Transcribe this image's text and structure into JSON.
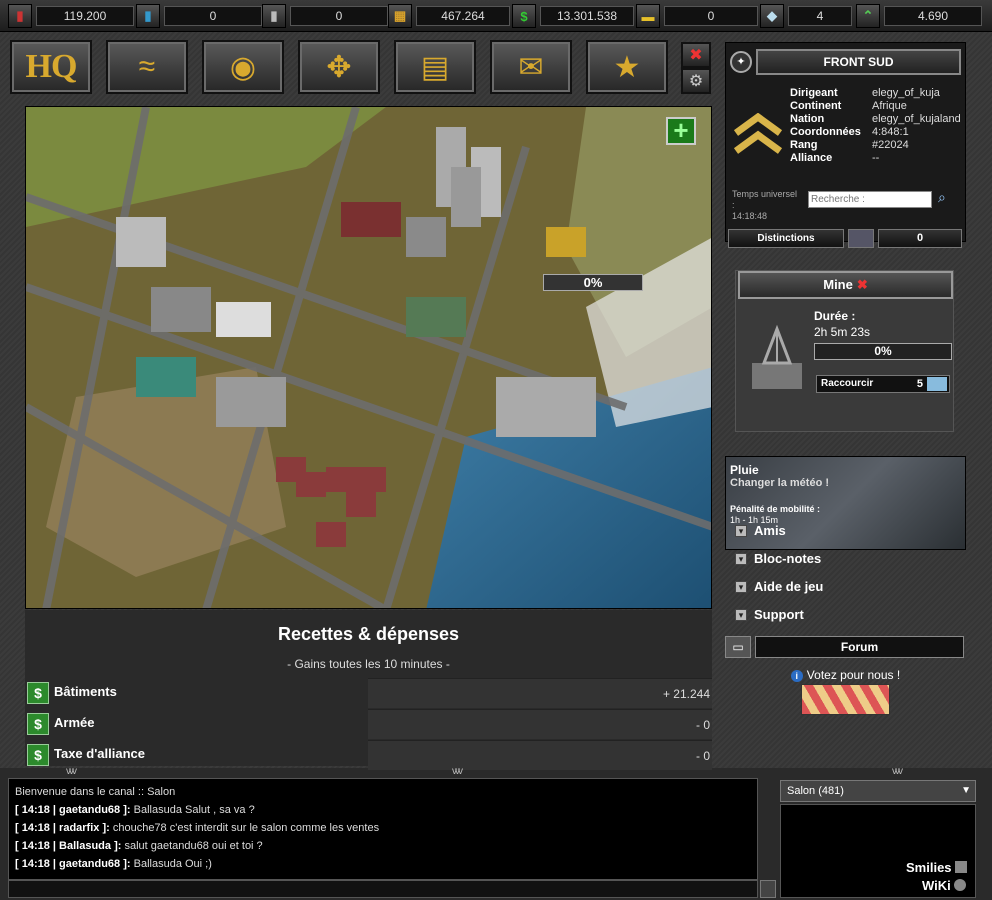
{
  "resources": [
    {
      "icon": "oil-barrel-icon",
      "glyph": "▮",
      "color": "#c33",
      "value": "119.200"
    },
    {
      "icon": "fuel-barrel-icon",
      "glyph": "▮",
      "color": "#39c",
      "value": "0"
    },
    {
      "icon": "steel-barrel-icon",
      "glyph": "▮",
      "color": "#bbb",
      "value": "0"
    },
    {
      "icon": "supply-crates-icon",
      "glyph": "▦",
      "color": "#d9a22a",
      "value": "467.264"
    },
    {
      "icon": "dollar-icon",
      "glyph": "$",
      "color": "#3c3",
      "value": "13.301.538"
    },
    {
      "icon": "gold-bar-icon",
      "glyph": "▬",
      "color": "#e6c02a",
      "value": "0"
    },
    {
      "icon": "diamond-icon",
      "glyph": "◆",
      "color": "#bde",
      "value": "4"
    },
    {
      "icon": "rank-up-icon",
      "glyph": "⌃",
      "color": "#5c5",
      "value": "4.690"
    }
  ],
  "nav": {
    "hq": "HQ",
    "items": [
      "map-icon",
      "globe-icon",
      "alliance-icon",
      "reports-icon",
      "mail-icon",
      "star-icon"
    ]
  },
  "map": {
    "progress": "0%"
  },
  "income": {
    "title": "Recettes & dépenses",
    "subtitle": "- Gains toutes les 10 minutes -",
    "rows": [
      {
        "label": "Bâtiments",
        "value": "+ 21.244"
      },
      {
        "label": "Armée",
        "value": "- 0"
      },
      {
        "label": "Taxe d'alliance",
        "value": "- 0"
      }
    ]
  },
  "front": {
    "title": "FRONT SUD",
    "info": [
      {
        "k": "Dirigeant",
        "v": "elegy_of_kuja"
      },
      {
        "k": "Continent",
        "v": "Afrique"
      },
      {
        "k": "Nation",
        "v": "elegy_of_kujaland"
      },
      {
        "k": "Coordonnées",
        "v": "4:848:1"
      },
      {
        "k": "Rang",
        "v": "#22024"
      },
      {
        "k": "Alliance",
        "v": "--"
      }
    ],
    "temps_label": "Temps universel :",
    "temps_value": "14:18:48",
    "search_placeholder": "Recherche :",
    "distinctions_label": "Distinctions",
    "distinctions_value": "0"
  },
  "mine": {
    "title": "Mine",
    "close": "✖",
    "duree_label": "Durée :",
    "duree_value": "2h 5m 23s",
    "progress": "0%",
    "raccourcir_label": "Raccourcir",
    "raccourcir_value": "5"
  },
  "weather": {
    "name": "Pluie",
    "action": "Changer la météo !",
    "penalty_label": "Pénalité de mobilité :",
    "penalty_value": "1h - 1h 15m"
  },
  "menu": [
    "Amis",
    "Bloc-notes",
    "Aide de jeu",
    "Support"
  ],
  "forum": "Forum",
  "vote": {
    "icon_glyph": "i",
    "text": "Votez pour nous !"
  },
  "chat": {
    "welcome": "Bienvenue dans le canal :: Salon",
    "lines": [
      {
        "meta": "[ 14:18 | gaetandu68 ]:",
        "text": "Ballasuda Salut , sa va ?"
      },
      {
        "meta": "[ 14:18 | radarfix ]:",
        "text": "chouche78 c'est interdit sur le salon comme les ventes"
      },
      {
        "meta": "[ 14:18 | Ballasuda ]:",
        "text": "salut gaetandu68 oui et toi ?"
      },
      {
        "meta": "[ 14:18 | gaetandu68 ]:",
        "text": "Ballasuda Oui ;)"
      }
    ],
    "channel": "Salon (481)",
    "smilies": "Smilies",
    "wiki": "WiKi"
  }
}
